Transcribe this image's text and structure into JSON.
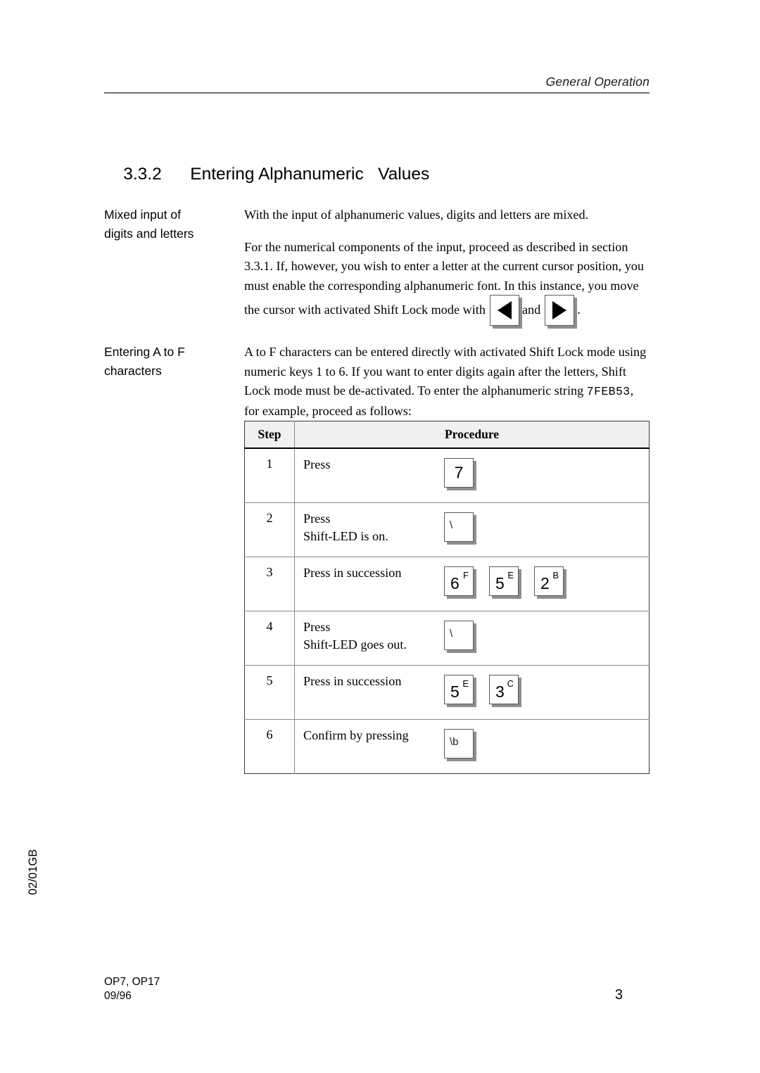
{
  "header": {
    "running_title": "General Operation"
  },
  "heading": {
    "number": "3.3.2",
    "title": "Entering Alphanumeric   Values"
  },
  "sections": [
    {
      "margin_label_line1": "Mixed input of",
      "margin_label_line2": "digits and letters",
      "paragraph1": "With the input of alphanumeric values, digits and letters are mixed.",
      "paragraph2_part1": "For the numerical components of the input, proceed as described in section 3.3.1. If, however, you wish to enter a letter at the current cursor position, you must enable the corresponding alphanumeric font. In this instance, you move the cursor with activated Shift Lock mode with",
      "paragraph2_conjunction": "and",
      "paragraph2_end": ".",
      "key_left_icon": "arrow-left-key",
      "key_right_icon": "arrow-right-key"
    },
    {
      "margin_label_line1": "Entering A to F",
      "margin_label_line2": "characters",
      "paragraph1_part1": "A to F characters can be entered directly with activated Shift Lock mode using numeric keys 1 to 6. If you want to enter digits again after the letters, Shift Lock mode must be de-activated. To enter the alphanumeric string",
      "paragraph1_mono": "7FEB53",
      "paragraph1_part2": ", for example, proceed as follows:"
    }
  ],
  "table": {
    "columns": [
      "Step",
      "Procedure"
    ],
    "rows": [
      {
        "step": "1",
        "text_line1": "Press",
        "text_line2": "",
        "keys": [
          {
            "main": "7",
            "sup": "",
            "sym": "",
            "centered": true
          }
        ]
      },
      {
        "step": "2",
        "text_line1": "Press",
        "text_line2": "Shift-LED is on.",
        "keys": [
          {
            "main": "",
            "sup": "",
            "sym": "\\",
            "centered": false
          }
        ]
      },
      {
        "step": "3",
        "text_line1": "Press in succession",
        "text_line2": "",
        "keys": [
          {
            "main": "6",
            "sup": "F",
            "sym": "",
            "centered": false
          },
          {
            "main": "5",
            "sup": "E",
            "sym": "",
            "centered": false
          },
          {
            "main": "2",
            "sup": "B",
            "sym": "",
            "centered": false
          }
        ]
      },
      {
        "step": "4",
        "text_line1": "Press",
        "text_line2": "Shift-LED goes out.",
        "keys": [
          {
            "main": "",
            "sup": "",
            "sym": "\\",
            "centered": false
          }
        ]
      },
      {
        "step": "5",
        "text_line1": "Press in succession",
        "text_line2": "",
        "keys": [
          {
            "main": "5",
            "sup": "E",
            "sym": "",
            "centered": false
          },
          {
            "main": "3",
            "sup": "C",
            "sym": "",
            "centered": false
          }
        ]
      },
      {
        "step": "6",
        "text_line1": "Confirm by pressing",
        "text_line2": "",
        "keys": [
          {
            "main": "",
            "sup": "",
            "sym": "\\b",
            "centered": false
          }
        ]
      }
    ]
  },
  "side_code": "02/01GB",
  "footer": {
    "device_line": "OP7, OP17",
    "date_line": "09/96",
    "page_number": "3"
  }
}
